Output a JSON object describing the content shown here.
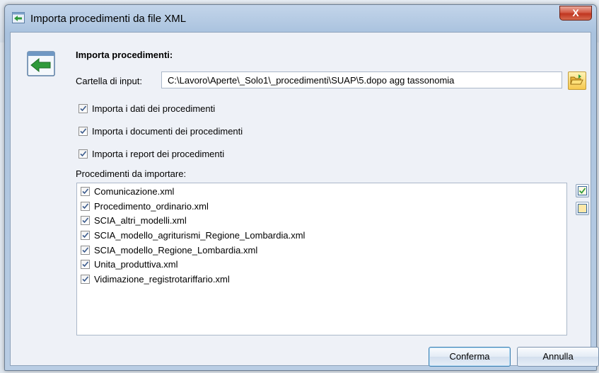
{
  "window": {
    "title": "Importa procedimenti da file XML",
    "close_glyph": "X"
  },
  "form": {
    "section_title": "Importa procedimenti:",
    "input_label": "Cartella di input:",
    "input_value": "C:\\Lavoro\\Aperte\\_Solo1\\_procedimenti\\SUAP\\5.dopo agg tassonomia",
    "options": [
      {
        "label": "Importa i dati dei procedimenti",
        "checked": true
      },
      {
        "label": "Importa i documenti dei procedimenti",
        "checked": true
      },
      {
        "label": "Importa i report dei procedimenti",
        "checked": true
      }
    ],
    "list_label": "Procedimenti da importare:",
    "list_items": [
      {
        "label": "Comunicazione.xml",
        "checked": true
      },
      {
        "label": "Procedimento_ordinario.xml",
        "checked": true
      },
      {
        "label": "SCIA_altri_modelli.xml",
        "checked": true
      },
      {
        "label": "SCIA_modello_agriturismi_Regione_Lombardia.xml",
        "checked": true
      },
      {
        "label": "SCIA_modello_Regione_Lombardia.xml",
        "checked": true
      },
      {
        "label": "Unita_produttiva.xml",
        "checked": true
      },
      {
        "label": "Vidimazione_registrotariffario.xml",
        "checked": true
      }
    ]
  },
  "buttons": {
    "confirm": "Conferma",
    "cancel": "Annulla"
  },
  "icons": {
    "app": "import-arrow-icon",
    "browse": "folder-open-icon",
    "select_all": "check-all-icon",
    "deselect_all": "uncheck-all-icon"
  },
  "colors": {
    "accent": "#3c7fb1",
    "close": "#c03620",
    "arrow_green": "#2e9a3a",
    "folder": "#f6c84e"
  }
}
